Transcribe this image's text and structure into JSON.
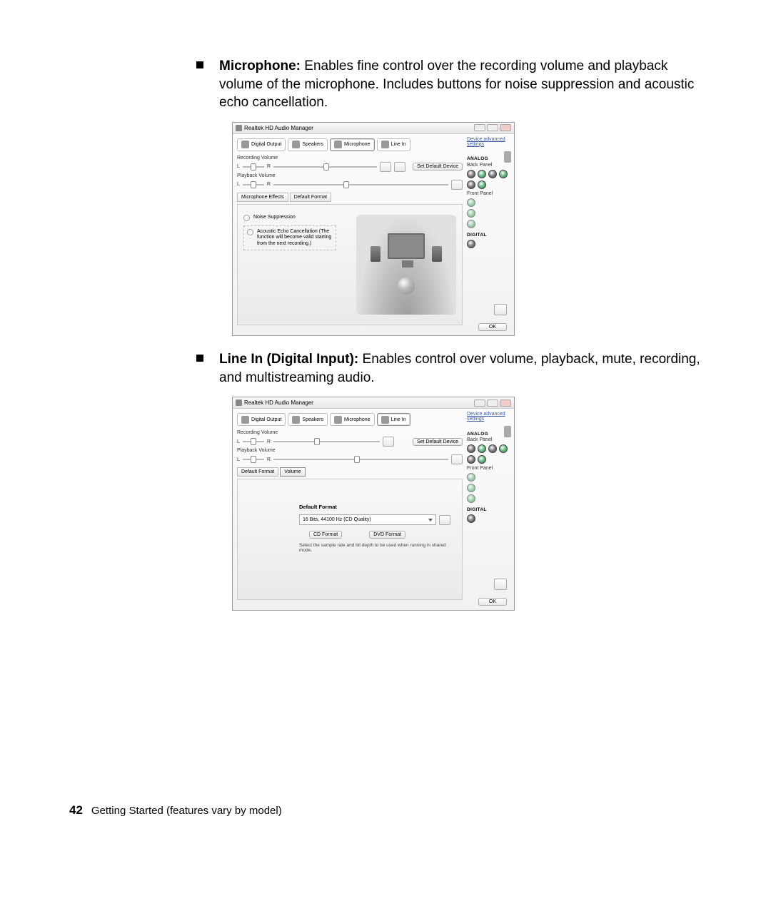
{
  "page": {
    "number": "42",
    "footer": "Getting Started (features vary by model)"
  },
  "section1": {
    "title": "Microphone:",
    "body": "Enables fine control over the recording volume and playback volume of the microphone. Includes buttons for noise suppression and acoustic echo cancellation."
  },
  "section2": {
    "title": "Line In (Digital Input):",
    "body": "Enables control over volume, playback, mute, recording, and multistreaming audio."
  },
  "shot": {
    "title": "Realtek HD Audio Manager",
    "advanced_link": "Device advanced settings",
    "rec_vol": "Recording Volume",
    "play_vol": "Playback Volume",
    "L": "L",
    "R": "R",
    "set_default": "Set Default Device",
    "mic_effects": "Microphone Effects",
    "default_format_tab": "Default Format",
    "volume_tab": "Volume",
    "noise_supp": "Noise Suppression",
    "aec": "Acoustic Echo Cancellation (The function will become valid starting from the next recording.)",
    "analog": "ANALOG",
    "back_panel": "Back Panel",
    "front_panel": "Front Panel",
    "digital": "DIGITAL",
    "ok": "OK",
    "tabs": {
      "digital_output": "Digital Output",
      "speakers": "Speakers",
      "microphone": "Microphone",
      "line_in": "Line In"
    },
    "def_format_heading": "Default Format",
    "def_format_value": "16 Bits, 44100 Hz (CD Quality)",
    "cd_format": "CD Format",
    "dvd_format": "DVD Format",
    "format_hint": "Select the sample rate and bit depth to be used when running in shared mode."
  }
}
